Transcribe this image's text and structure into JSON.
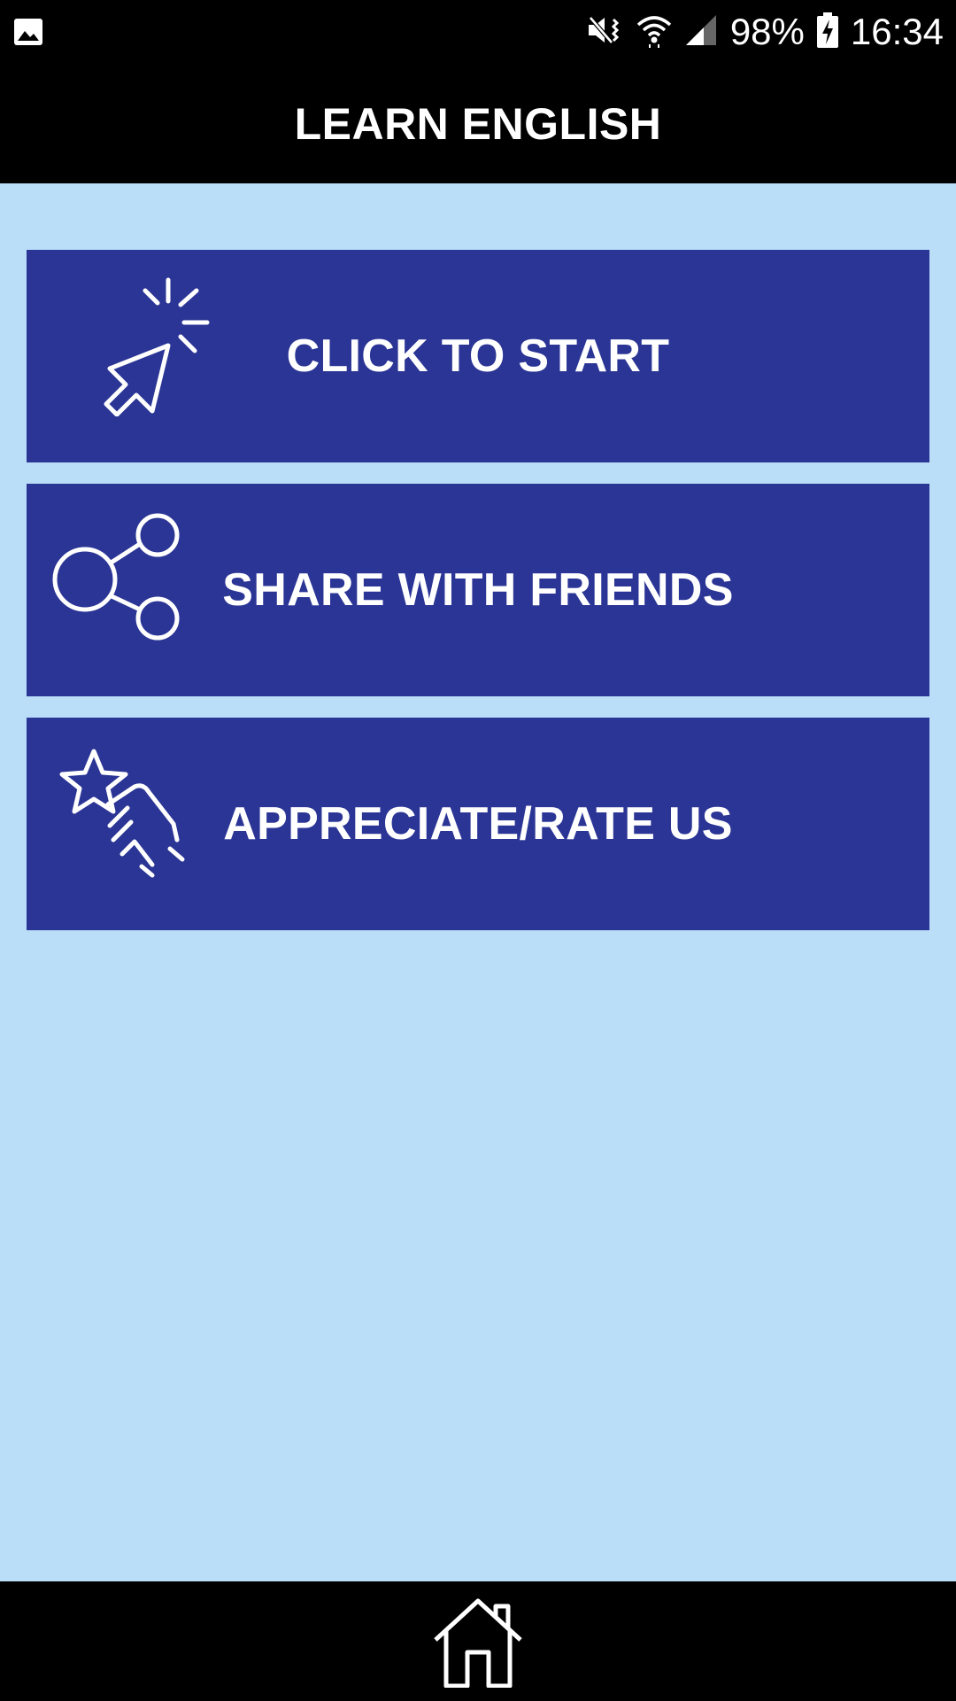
{
  "status_bar": {
    "left_icon": "image-notification-icon",
    "icons": [
      "vibrate-icon",
      "wifi-icon",
      "signal-icon"
    ],
    "battery_percent": "98%",
    "battery_icon": "battery-charging-icon",
    "time": "16:34"
  },
  "app_bar": {
    "title": "LEARN ENGLISH"
  },
  "menu": {
    "items": [
      {
        "label": "CLICK TO START",
        "icon": "cursor-click-icon"
      },
      {
        "label": "SHARE WITH FRIENDS",
        "icon": "share-icon"
      },
      {
        "label": "APPRECIATE/RATE US",
        "icon": "rate-star-hand-icon"
      }
    ]
  },
  "nav_bar": {
    "icon": "home-icon"
  },
  "colors": {
    "background": "#bbdef8",
    "button": "#2b3595",
    "bars": "#000000",
    "text": "#ffffff"
  }
}
